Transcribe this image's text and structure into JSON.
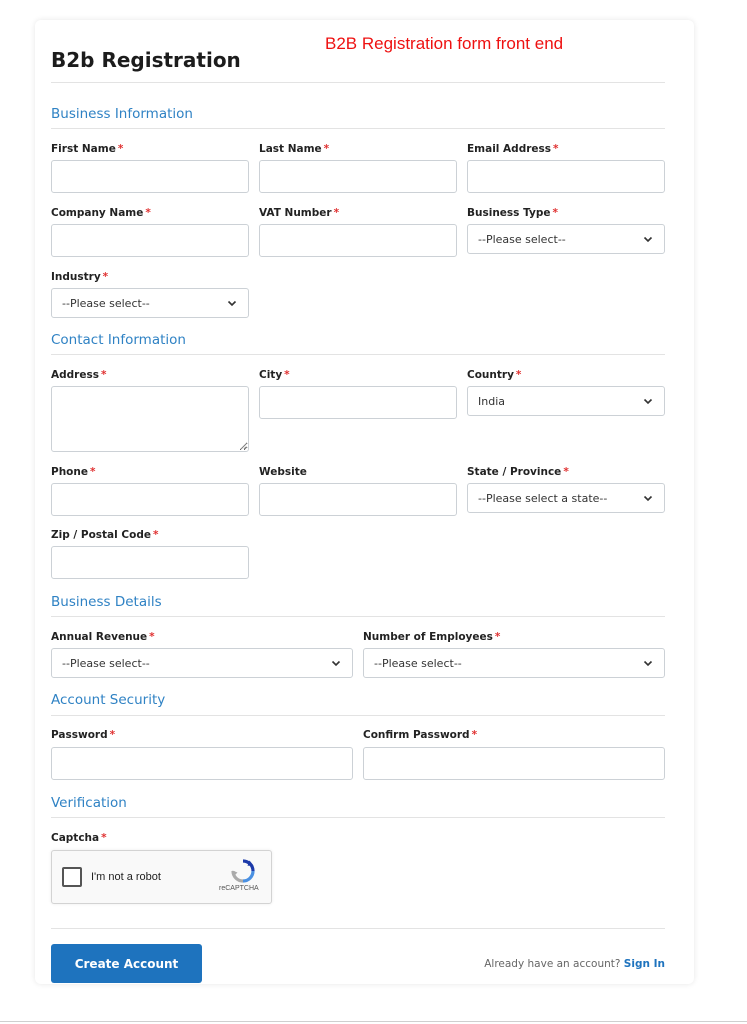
{
  "page": {
    "title": "B2b Registration",
    "annotation": "B2B Registration form front end"
  },
  "sections": {
    "business_information": "Business Information",
    "contact_information": "Contact Information",
    "business_details": "Business Details",
    "account_security": "Account Security",
    "verification": "Verification"
  },
  "required_marker": "*",
  "fields": {
    "first_name": {
      "label": "First Name",
      "value": ""
    },
    "last_name": {
      "label": "Last Name",
      "value": ""
    },
    "email": {
      "label": "Email Address",
      "value": ""
    },
    "company_name": {
      "label": "Company Name",
      "value": ""
    },
    "vat_number": {
      "label": "VAT Number",
      "value": ""
    },
    "business_type": {
      "label": "Business Type",
      "selected": "--Please select--"
    },
    "industry": {
      "label": "Industry",
      "selected": "--Please select--"
    },
    "address": {
      "label": "Address",
      "value": ""
    },
    "city": {
      "label": "City",
      "value": ""
    },
    "country": {
      "label": "Country",
      "selected": "India"
    },
    "phone": {
      "label": "Phone",
      "value": ""
    },
    "website": {
      "label": "Website",
      "value": ""
    },
    "state": {
      "label": "State / Province",
      "selected": "--Please select a state--"
    },
    "zip": {
      "label": "Zip / Postal Code",
      "value": ""
    },
    "annual_revenue": {
      "label": "Annual Revenue",
      "selected": "--Please select--"
    },
    "employees": {
      "label": "Number of Employees",
      "selected": "--Please select--"
    },
    "password": {
      "label": "Password",
      "value": ""
    },
    "confirm_password": {
      "label": "Confirm Password",
      "value": ""
    },
    "captcha": {
      "label": "Captcha"
    }
  },
  "recaptcha": {
    "checkbox_label": "I'm not a robot",
    "brand": "reCAPTCHA",
    "checked": false
  },
  "footer": {
    "submit_label": "Create Account",
    "signin_prompt": "Already have an account?",
    "signin_link": "Sign In"
  },
  "icons": {
    "select_arrow": "chevron-down-icon",
    "recaptcha_logo": "recaptcha-logo-icon"
  },
  "colors": {
    "accent": "#1e73be",
    "section_title": "#2f82c4",
    "required": "#e03131",
    "annotation": "#ee1111"
  }
}
